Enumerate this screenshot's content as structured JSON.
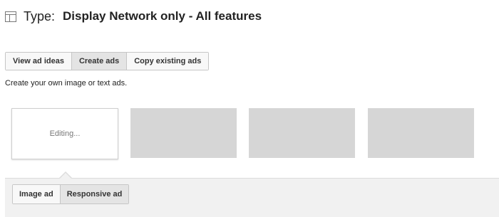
{
  "header": {
    "icon": "layout-panel-icon",
    "type_label": "Type:",
    "type_value": "Display Network only - All features"
  },
  "tabs": [
    {
      "label": "View ad ideas",
      "active": false
    },
    {
      "label": "Create ads",
      "active": true
    },
    {
      "label": "Copy existing ads",
      "active": false
    }
  ],
  "subtitle": "Create your own image or text ads.",
  "thumbnails": {
    "editing_label": "Editing..."
  },
  "ad_type_tabs": [
    {
      "label": "Image ad",
      "active": false
    },
    {
      "label": "Responsive ad",
      "active": true
    }
  ],
  "colors": {
    "placeholder": "#d6d6d6",
    "panel": "#f1f1f1",
    "active_tab": "#e4e4e4"
  }
}
